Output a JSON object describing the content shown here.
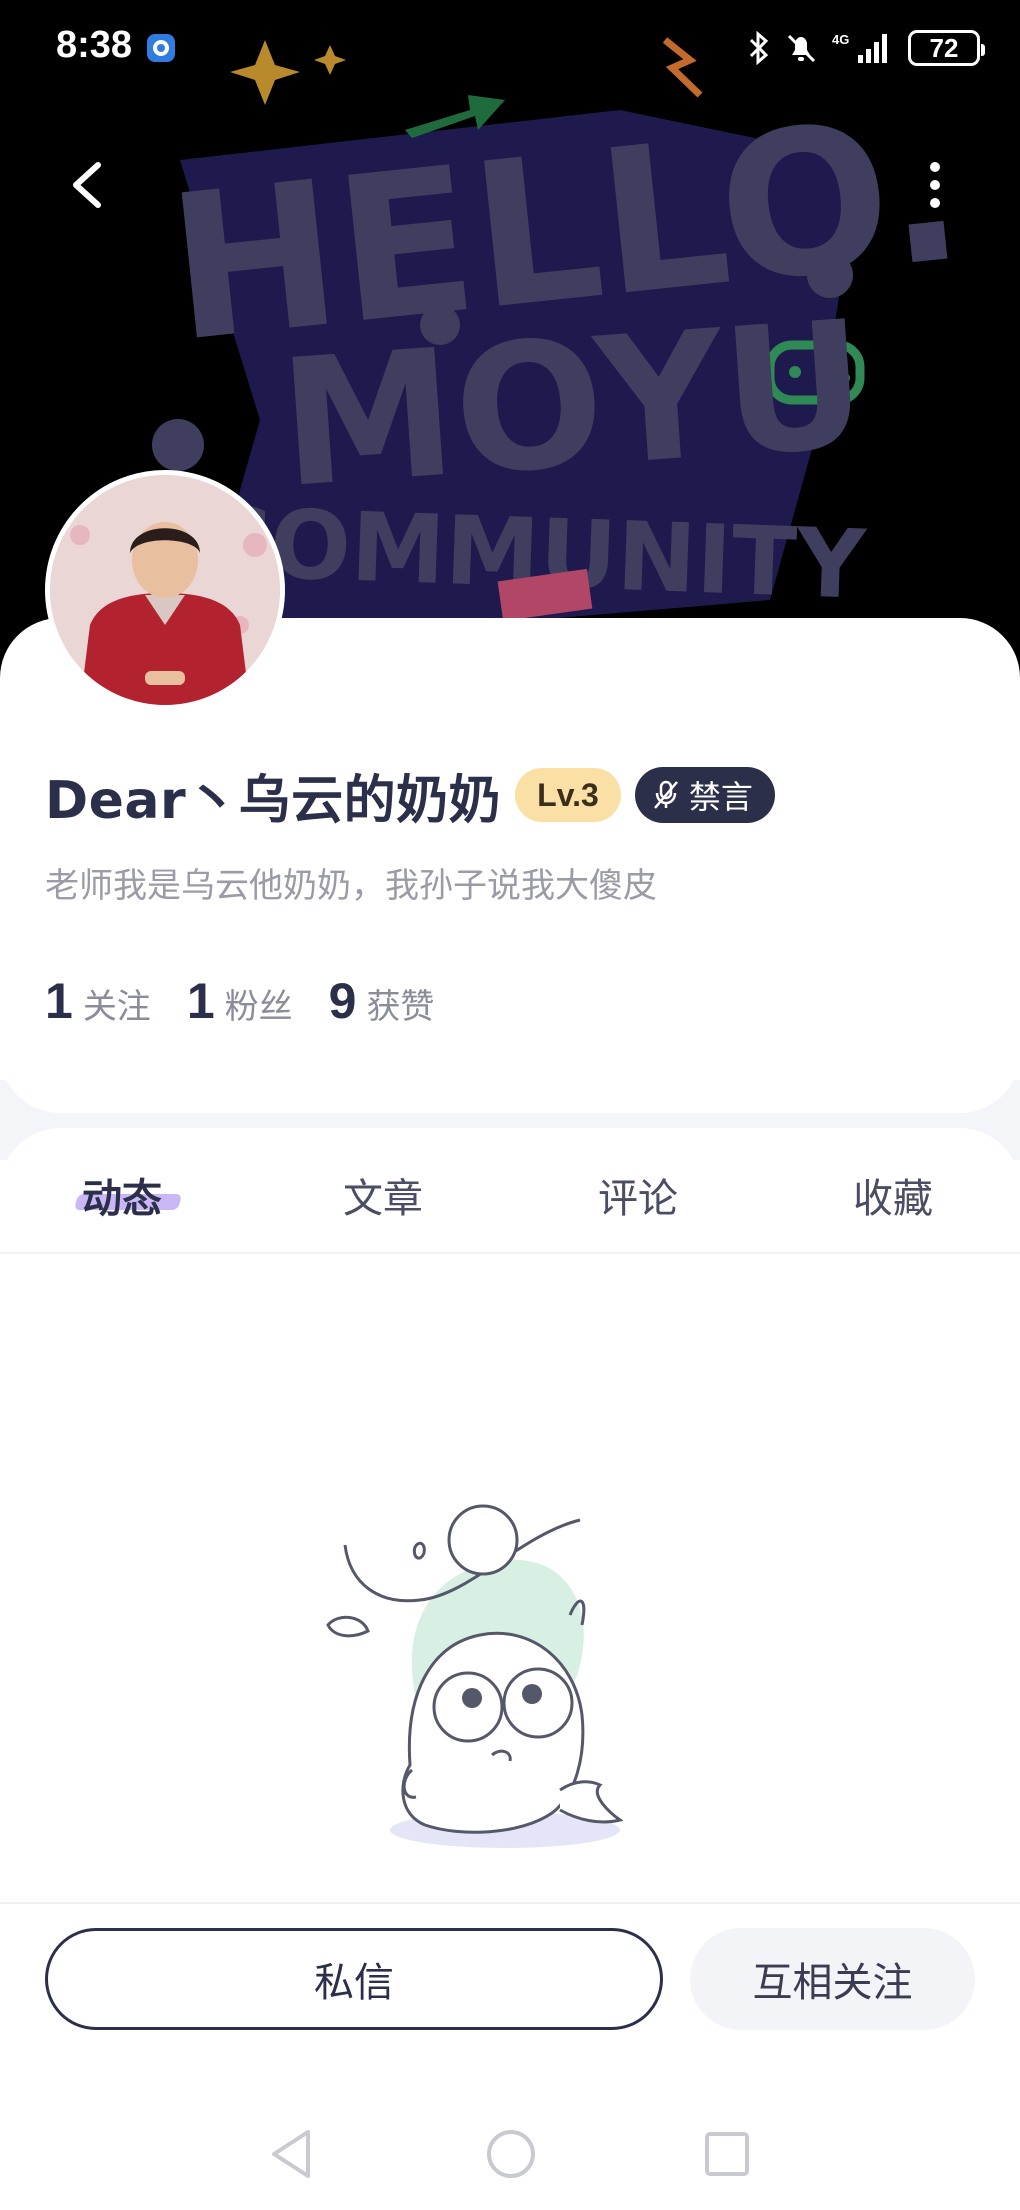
{
  "status_bar": {
    "time": "8:38",
    "network": "4G",
    "battery": "72"
  },
  "banner": {
    "art_line1": "HELLO.",
    "art_line2": "MOYU",
    "art_line3": "COMMUNITY",
    "bg_color": "#000000",
    "art_color": "#3f3e5e"
  },
  "profile": {
    "username": "Dear丶乌云的奶奶",
    "level": "Lv.3",
    "mute_label": "禁言",
    "bio": "老师我是乌云他奶奶，我孙子说我大傻皮",
    "stats": [
      {
        "num": "1",
        "label": "关注"
      },
      {
        "num": "1",
        "label": "粉丝"
      },
      {
        "num": "9",
        "label": "获赞"
      }
    ]
  },
  "tabs": [
    {
      "label": "动态",
      "active": true
    },
    {
      "label": "文章",
      "active": false
    },
    {
      "label": "评论",
      "active": false
    },
    {
      "label": "收藏",
      "active": false
    }
  ],
  "actions": {
    "message": "私信",
    "follow": "互相关注"
  },
  "colors": {
    "text_dark": "#2b2f4a",
    "level_badge": "#fbe0a6",
    "tab_accent": "#c9b8f5",
    "illustration_mint": "#d7f0e3"
  }
}
